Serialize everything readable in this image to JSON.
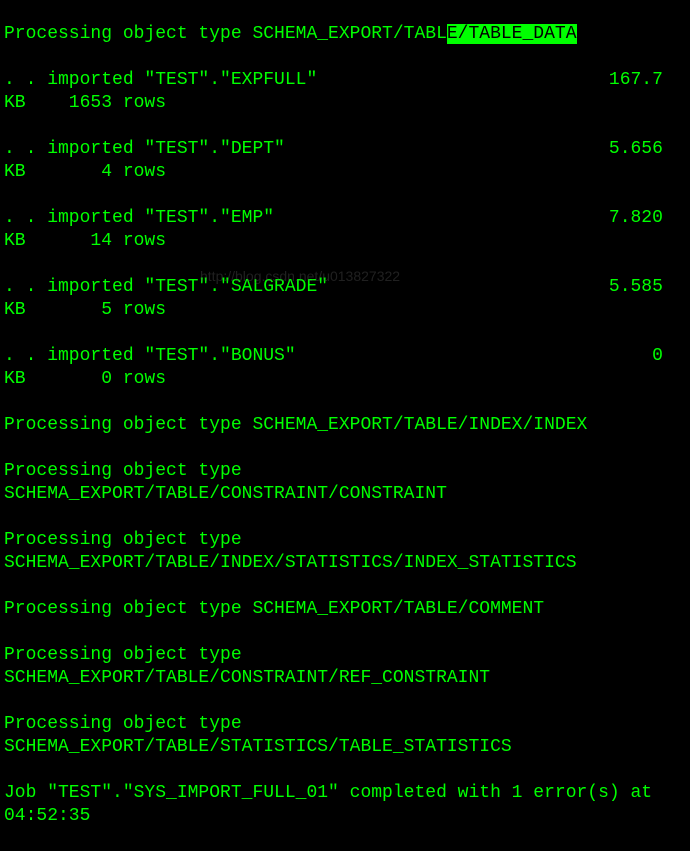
{
  "terminal": {
    "line1_prefix": "Processing object type SCHEMA_EXPORT/TABL",
    "line1_highlight": "E/TABLE_DATA",
    "import1": ". . imported \"TEST\".\"EXPFULL\"                           167.7 KB    1653 rows",
    "import2": ". . imported \"TEST\".\"DEPT\"                              5.656 KB       4 rows",
    "import3": ". . imported \"TEST\".\"EMP\"                               7.820 KB      14 rows",
    "import4": ". . imported \"TEST\".\"SALGRADE\"                          5.585 KB       5 rows",
    "import5": ". . imported \"TEST\".\"BONUS\"                                 0 KB       0 rows",
    "proc1": "Processing object type SCHEMA_EXPORT/TABLE/INDEX/INDEX",
    "proc2": "Processing object type SCHEMA_EXPORT/TABLE/CONSTRAINT/CONSTRAINT",
    "proc3": "Processing object type SCHEMA_EXPORT/TABLE/INDEX/STATISTICS/INDEX_STATISTICS",
    "proc4": "Processing object type SCHEMA_EXPORT/TABLE/COMMENT",
    "proc5": "Processing object type SCHEMA_EXPORT/TABLE/CONSTRAINT/REF_CONSTRAINT",
    "proc6": "Processing object type SCHEMA_EXPORT/TABLE/STATISTICS/TABLE_STATISTICS",
    "completion": "Job \"TEST\".\"SYS_IMPORT_FULL_01\" completed with 1 error(s) at 04:52:35"
  },
  "watermark": "http://blog.csdn.net/u013827322"
}
